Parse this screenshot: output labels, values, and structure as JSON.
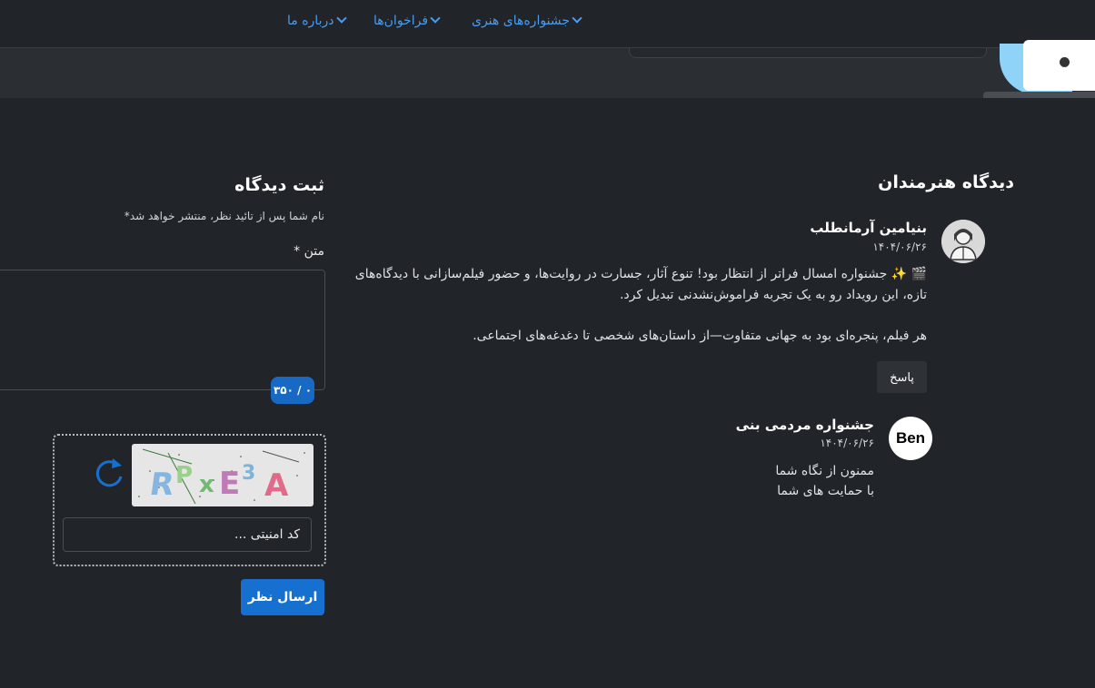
{
  "nav": {
    "items": [
      {
        "label": "جشنواره‌های هنری"
      },
      {
        "label": "فراخوان‌ها"
      },
      {
        "label": "درباره ما"
      }
    ]
  },
  "form": {
    "title": "ثبت دیدگاه",
    "notice": "نام شما پس از تائید نظر، منتشر خواهد شد*",
    "text_label": "متن *",
    "counter": "۰ / ۳۵۰",
    "captcha_chars": [
      "R",
      "P",
      "x",
      "E",
      "3",
      "A"
    ],
    "captcha_placeholder": "کد امنیتی ...",
    "submit_label": "ارسال نظر"
  },
  "comments": {
    "title": "دیدگاه هنرمندان",
    "items": [
      {
        "author": "بنیامین آرمانطلب",
        "date": "۱۴۰۴/۰۶/۲۶",
        "line1": "🎬 ✨ جشنواره امسال فراتر از انتظار بود! تنوع آثار، جسارت در روایت‌ها، و حضور فیلم‌سازانی با دیدگاه‌های",
        "line2": "تازه، این رویداد رو به یک تجربه فراموش‌نشدنی تبدیل کرد.",
        "line3": "هر فیلم، پنجره‌ای بود به جهانی متفاوت—از داستان‌های شخصی تا دغدغه‌های اجتماعی.",
        "reply_label": "پاسخ"
      },
      {
        "author": "جشنواره مردمی بنی",
        "avatar_text": "Ben",
        "date": "۱۴۰۴/۰۶/۲۶",
        "line1": "ممنون از نگاه شما",
        "line2": "با حمایت های شما"
      }
    ]
  },
  "colors": {
    "background": "#212428",
    "accent": "#1670d0",
    "link": "#4a9df0"
  }
}
